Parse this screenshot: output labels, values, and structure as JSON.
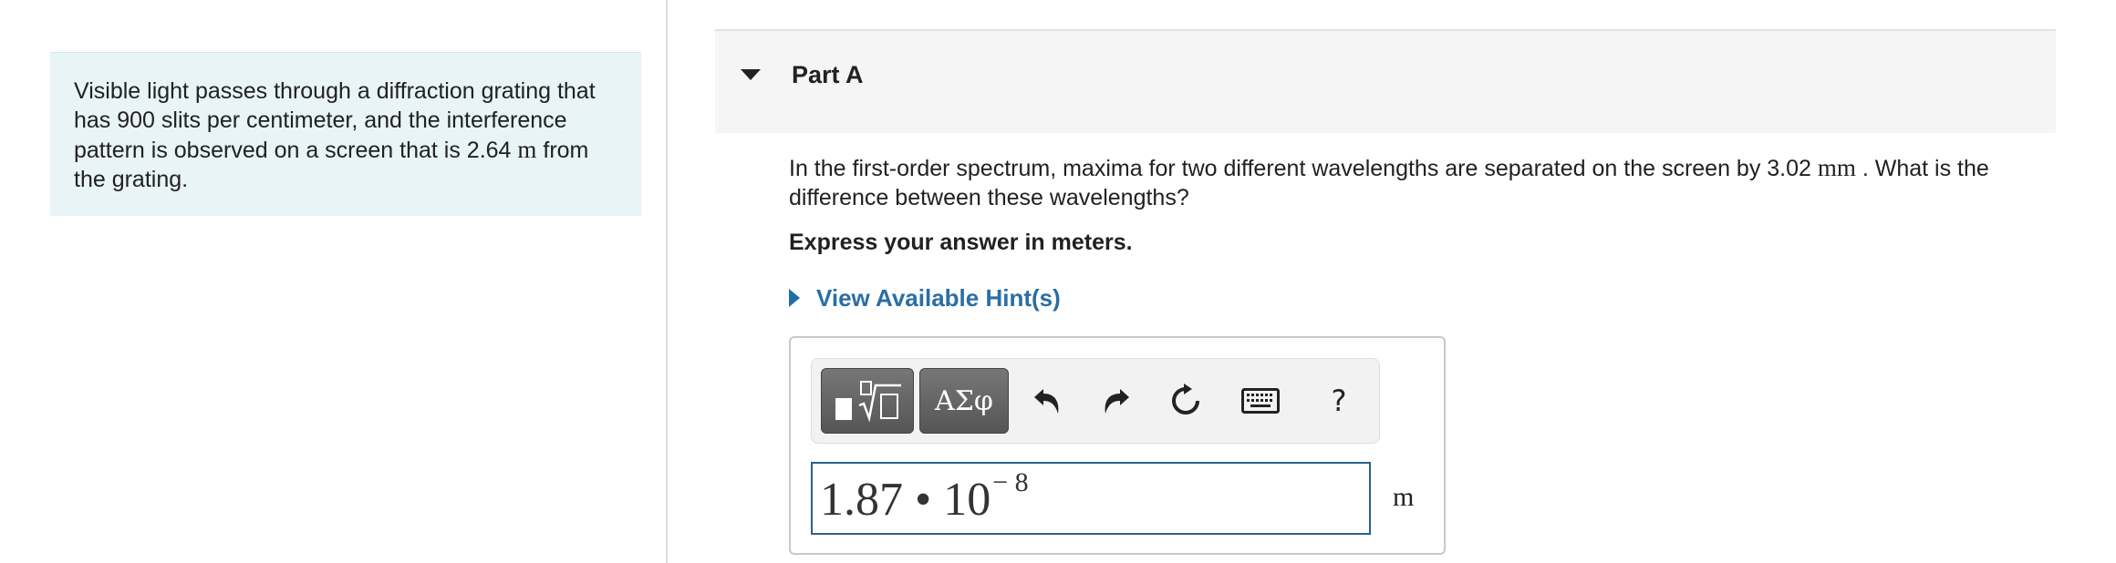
{
  "problem": {
    "text_before": "Visible light passes through a diffraction grating that has 900 slits per centimeter, and the interference pattern is observed on a screen that is 2.64 ",
    "unit": "m",
    "text_after": " from the grating."
  },
  "part": {
    "title": "Part A"
  },
  "question": {
    "text_before": "In the first-order spectrum, maxima for two different wavelengths are separated on the screen by 3.02 ",
    "unit": "mm",
    "text_after": " . What is the difference between these wavelengths?"
  },
  "instruction": "Express your answer in meters.",
  "hint": {
    "label": "View Available Hint(s)"
  },
  "toolbar": {
    "symbols_label": "ΑΣφ",
    "help_label": "?",
    "icons": [
      "templates-icon",
      "undo-icon",
      "redo-icon",
      "reset-icon",
      "keyboard-icon"
    ]
  },
  "answer": {
    "mantissa": "1.87",
    "operator": "•",
    "base": "10",
    "exponent": "− 8",
    "unit": "m"
  },
  "colors": {
    "problem_bg": "#e8f4f6",
    "header_bg": "#f5f5f5",
    "hint_link": "#2a6ea5",
    "input_border": "#2b5f8c"
  }
}
